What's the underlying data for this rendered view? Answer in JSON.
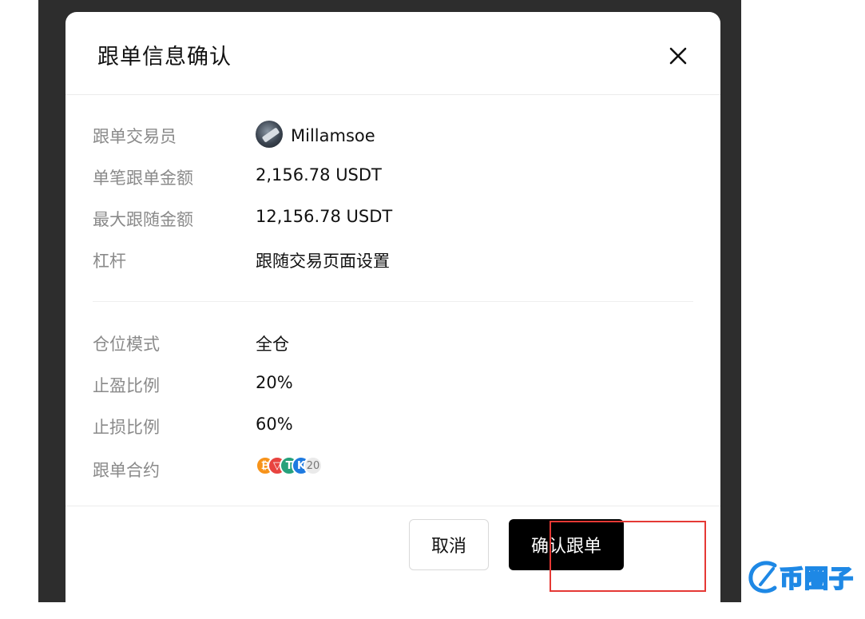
{
  "dialog": {
    "title": "跟单信息确认"
  },
  "details": [
    {
      "label": "跟单交易员",
      "value": "Millamsoe"
    },
    {
      "label": "单笔跟单金额",
      "value": "2,156.78 USDT"
    },
    {
      "label": "最大跟随金额",
      "value": "12,156.78 USDT"
    },
    {
      "label": "杠杆",
      "value": "跟随交易页面设置"
    }
  ],
  "settings": [
    {
      "label": "仓位模式",
      "value": "全仓"
    },
    {
      "label": "止盈比例",
      "value": "20%"
    },
    {
      "label": "止损比例",
      "value": "60%"
    },
    {
      "label": "跟单合约",
      "value": ""
    }
  ],
  "contracts": {
    "coins": [
      {
        "name": "bitcoin-coin-icon",
        "glyph": "₿",
        "color": "#f7931a"
      },
      {
        "name": "tron-coin-icon",
        "glyph": "▽",
        "color": "#e8433f"
      },
      {
        "name": "tether-coin-icon",
        "glyph": "T",
        "color": "#26a17b"
      },
      {
        "name": "kcs-coin-icon",
        "glyph": "K",
        "color": "#1e7ae0"
      }
    ],
    "more_count": "20"
  },
  "buttons": {
    "cancel": "取消",
    "confirm": "确认跟单"
  },
  "watermark": {
    "text": "币圈子"
  },
  "colors": {
    "backdrop": "#2d2d2d",
    "label": "#8a8a8a",
    "confirm_bg": "#000000",
    "highlight": "#e53935"
  }
}
